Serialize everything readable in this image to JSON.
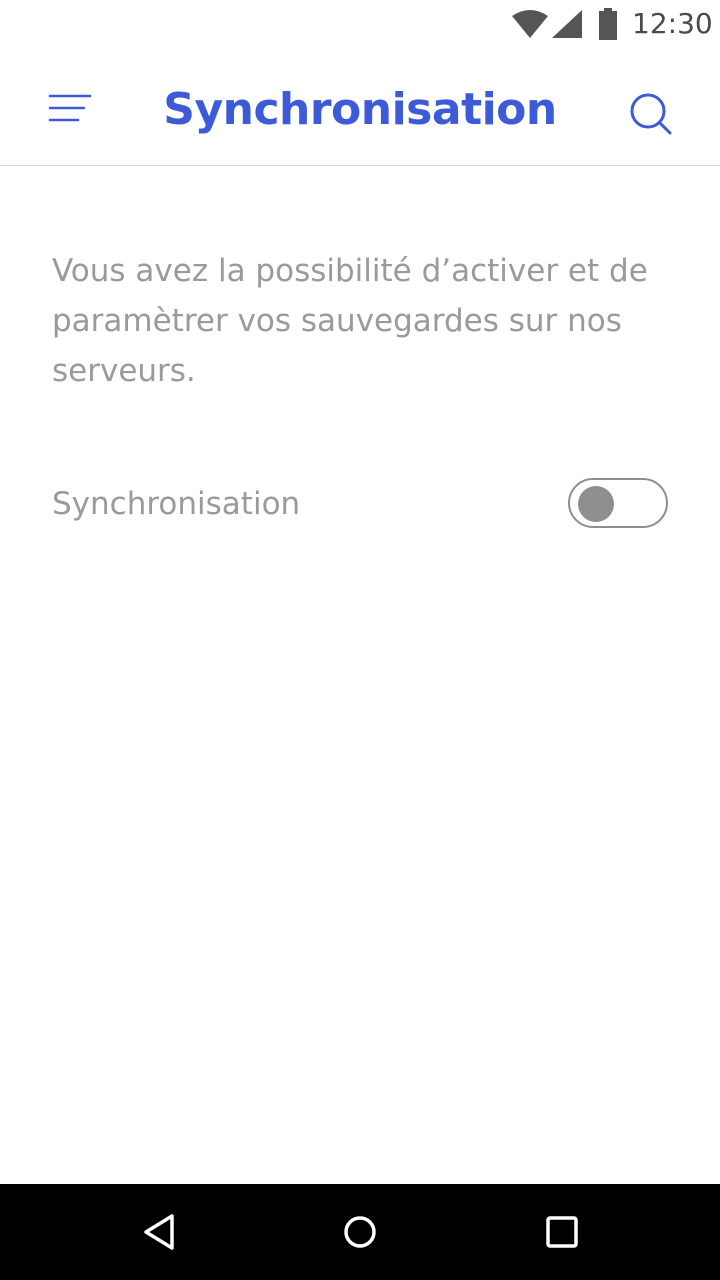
{
  "status_bar": {
    "time": "12:30",
    "icons": [
      "wifi-icon",
      "cellular-signal-icon",
      "battery-icon"
    ]
  },
  "app_bar": {
    "title": "Synchronisation",
    "menu_icon": "menu-icon",
    "search_icon": "search-icon",
    "accent_color": "#3d5bd9"
  },
  "content": {
    "description": "Vous avez la possibilité d’activer et de paramètrer vos sauvegardes sur nos serveurs.",
    "setting": {
      "label": "Synchronisation",
      "enabled": false
    }
  },
  "nav_bar": {
    "icons": [
      "back-icon",
      "home-icon",
      "recent-apps-icon"
    ]
  }
}
